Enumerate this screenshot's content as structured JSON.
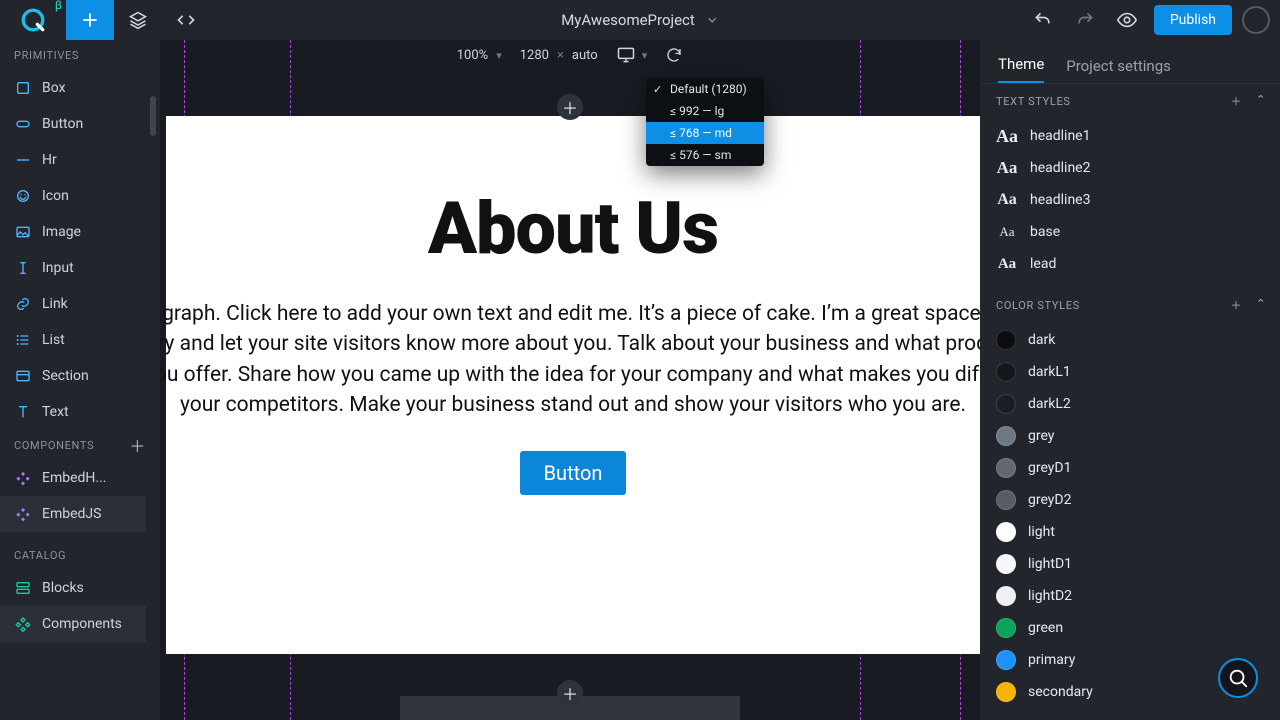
{
  "header": {
    "project_name": "MyAwesomeProject",
    "publish_label": "Publish"
  },
  "canvas_bar": {
    "zoom": "100%",
    "width": "1280",
    "sep": "×",
    "height": "auto"
  },
  "breakpoints": {
    "items": [
      {
        "label": "Default (1280)",
        "checked": true
      },
      {
        "label": "≤ 992 — lg"
      },
      {
        "label": "≤ 768 — md",
        "selected": true
      },
      {
        "label": "≤ 576 — sm"
      }
    ]
  },
  "left": {
    "primitives_title": "PRIMITIVES",
    "primitives": [
      "Box",
      "Button",
      "Hr",
      "Icon",
      "Image",
      "Input",
      "Link",
      "List",
      "Section",
      "Text"
    ],
    "components_title": "COMPONENTS",
    "components": [
      "EmbedH...",
      "EmbedJS"
    ],
    "catalog_title": "CATALOG",
    "catalog": [
      "Blocks",
      "Components"
    ]
  },
  "page": {
    "title": "About Us",
    "paragraph": "I'm a paragraph. Click here to add your own text and edit me. It’s a piece of cake. I’m a great space for you to tell a story and let your site visitors know more about you. Talk about your business and what products and services you offer. Share how you came up with the idea for your company and what makes you different from your competitors. Make your business stand out and show your visitors who you are.",
    "button_label": "Button"
  },
  "right": {
    "tabs": {
      "theme": "Theme",
      "project": "Project settings"
    },
    "text_styles_title": "TEXT STYLES",
    "text_styles": [
      "headline1",
      "headline2",
      "headline3",
      "base",
      "lead"
    ],
    "color_styles_title": "COLOR STYLES",
    "color_styles": [
      {
        "name": "dark",
        "hex": "#0b0d10"
      },
      {
        "name": "darkL1",
        "hex": "#14171c"
      },
      {
        "name": "darkL2",
        "hex": "#1b1f25"
      },
      {
        "name": "grey",
        "hex": "#6e7884"
      },
      {
        "name": "greyD1",
        "hex": "#5f6873"
      },
      {
        "name": "greyD2",
        "hex": "#555d68"
      },
      {
        "name": "light",
        "hex": "#ffffff"
      },
      {
        "name": "lightD1",
        "hex": "#f6f7f9"
      },
      {
        "name": "lightD2",
        "hex": "#eef0f3"
      },
      {
        "name": "green",
        "hex": "#0aa35a"
      },
      {
        "name": "primary",
        "hex": "#1e90ff"
      },
      {
        "name": "secondary",
        "hex": "#f5b400"
      }
    ]
  }
}
